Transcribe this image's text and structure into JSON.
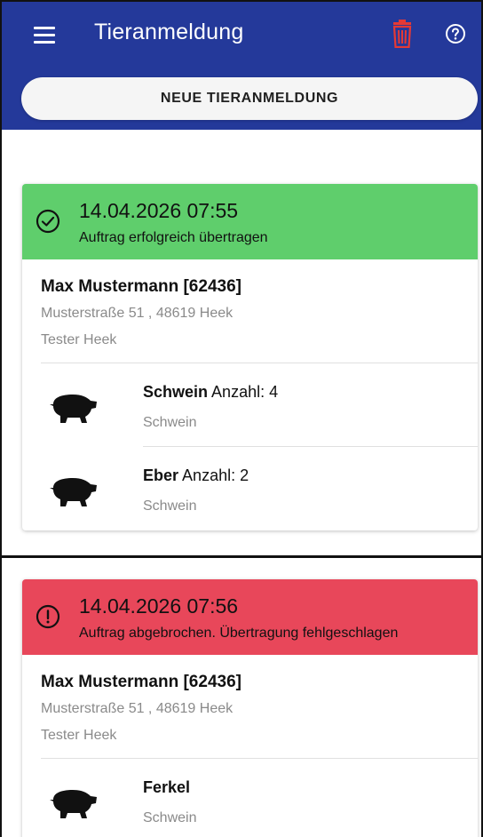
{
  "appbar": {
    "title": "Tieranmeldung",
    "menu_icon": "hamburger-menu-icon",
    "trash_icon": "trash-icon",
    "help_icon": "help-circle-icon",
    "new_button_label": "NEUE TIERANMELDUNG"
  },
  "colors": {
    "appbar": "#24399a",
    "success": "#5fce6c",
    "error": "#e8475a",
    "trash": "#e53935"
  },
  "cards": [
    {
      "status": "success",
      "status_icon": "check-circle-icon",
      "date": "14.04.2026 07:55",
      "message": "Auftrag erfolgreich übertragen",
      "customer": "Max Mustermann [62436]",
      "address": "Musterstraße 51 , 48619 Heek",
      "location": "Tester Heek",
      "animals": [
        {
          "name": "Schwein",
          "count_label": "Anzahl: 4",
          "type": "Schwein",
          "icon": "pig-icon"
        },
        {
          "name": "Eber",
          "count_label": "Anzahl: 2",
          "type": "Schwein",
          "icon": "pig-icon"
        }
      ]
    },
    {
      "status": "error",
      "status_icon": "alert-circle-icon",
      "date": "14.04.2026 07:56",
      "message": "Auftrag abgebrochen. Übertragung fehlgeschlagen",
      "customer": "Max Mustermann [62436]",
      "address": "Musterstraße 51 , 48619 Heek",
      "location": "Tester Heek",
      "animals": [
        {
          "name": "Ferkel",
          "count_label": "",
          "type": "Schwein",
          "icon": "pig-icon"
        }
      ]
    }
  ]
}
